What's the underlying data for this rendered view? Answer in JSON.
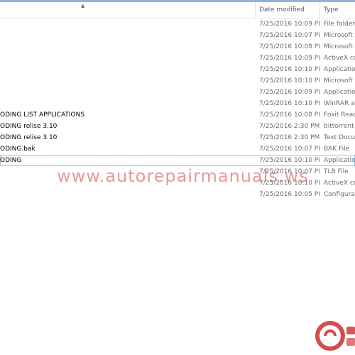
{
  "header": {
    "date_modified": "Date modified",
    "type": "Type"
  },
  "files": [
    {
      "name": "",
      "date": "7/25/2016 10:09 PM",
      "type": "File folder"
    },
    {
      "name": "",
      "date": "7/25/2016 10:07 PM",
      "type": "Microsoft A"
    },
    {
      "name": "",
      "date": "7/25/2016 10:08 PM",
      "type": "Microsoft A"
    },
    {
      "name": "",
      "date": "7/25/2016 10:09 PM",
      "type": "ActiveX con"
    },
    {
      "name": "",
      "date": "7/25/2016 10:10 PM",
      "type": "Application"
    },
    {
      "name": "",
      "date": "7/25/2016 10:10 PM",
      "type": "Microsoft A"
    },
    {
      "name": "",
      "date": "7/25/2016 10:09 PM",
      "type": "Application"
    },
    {
      "name": "",
      "date": "7/25/2016 10:10 PM",
      "type": "WinRAR arc"
    },
    {
      "name": "ODING LIST APPLICATIONS",
      "date": "7/25/2016 10:08 PM",
      "type": "Foxit Reade"
    },
    {
      "name": "ODING relise 3.10",
      "date": "7/25/2016 2:30 PM",
      "type": "bittorrent U"
    },
    {
      "name": "ODING relise 3.10",
      "date": "7/25/2016 2:30 PM",
      "type": "Text Docum"
    },
    {
      "name": "ODING.bak",
      "date": "7/25/2016 10:07 PM",
      "type": "BAK File"
    },
    {
      "name": "ODING",
      "date": "7/25/2016 10:10 PM",
      "type": "Application"
    },
    {
      "name": "",
      "date": "7/25/2016 10:07 PM",
      "type": "TLB File"
    },
    {
      "name": "",
      "date": "7/25/2016 10:10 PM",
      "type": "ActiveX con"
    },
    {
      "name": "",
      "date": "7/25/2016 10:05 PM",
      "type": "Configuratio"
    }
  ],
  "watermark": "www.autorepairmanuals.ws",
  "colors": {
    "selection_border": "#9dc0e4",
    "header_text": "#4c607a",
    "watermark": "#cd4646"
  }
}
